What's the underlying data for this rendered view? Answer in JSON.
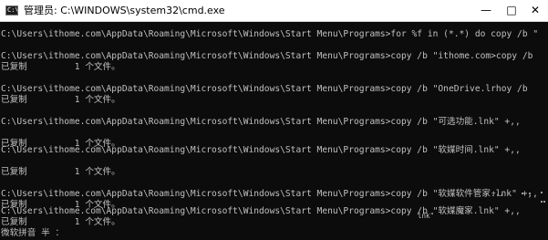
{
  "window": {
    "title": "管理员: C:\\WINDOWS\\system32\\cmd.exe",
    "icon_label": "C:\\",
    "icon": "cmd-icon",
    "controls": {
      "minimize": "—",
      "maximize": "□",
      "close": "✕"
    },
    "colors": {
      "console_bg": "#0c0c0c",
      "console_text": "#c0c0c0",
      "titlebar_bg": "#ffffff"
    }
  },
  "console": {
    "lines": [
      "C:\\Users\\ithome.com\\AppData\\Roaming\\Microsoft\\Windows\\Start Menu\\Programs>for %f in (*.*) do copy /b \"%f\" +,,",
      "",
      "C:\\Users\\ithome.com\\AppData\\Roaming\\Microsoft\\Windows\\Start Menu\\Programs>copy /b \"ithome.com>copy /b",
      "已复制         1 个文件。",
      "",
      "C:\\Users\\ithome.com\\AppData\\Roaming\\Microsoft\\Windows\\Start Menu\\Programs>copy /b \"OneDrive.lrhoy /b",
      "已复制         1 个文件。",
      "",
      "C:\\Users\\ithome.com\\AppData\\Roaming\\Microsoft\\Windows\\Start Menu\\Programs>copy /b \"可选功能.lnk\" +,,",
      "",
      "已复制         1 个文件。",
      "",
      "C:\\Users\\ithome.com\\AppData\\Roaming\\Microsoft\\Windows\\Start Menu\\Programs>copy /b \"软媒时间.lnk\" +,,",
      "",
      "已复制         1 个文件。",
      "",
      "C:\\Users\\ithome.com\\AppData\\Roaming\\Microsoft\\Windows\\Start Menu\\Programs>copy /b \"软媒软件管家.lnk\" +,,",
      "已复制         1 个文件。",
      "",
      "C:\\Users\\ithome.com\\AppData\\Roaming\\Microsoft\\Windows\\Start Menu\\Programs>copy /b \"软媒魔家.lnk\" +,,",
      "已复制         1 个文件。",
      "微软拼音 半 ："
    ],
    "stray_fragments": {
      "after_manager": "+,,",
      "after_magic": "lnk\""
    }
  }
}
